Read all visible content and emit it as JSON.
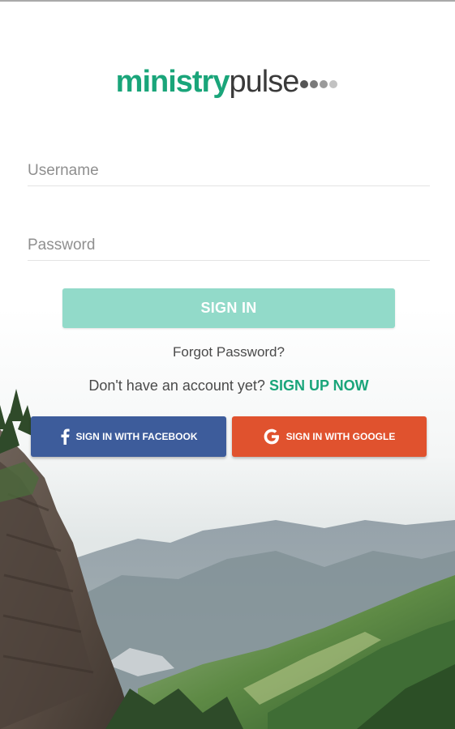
{
  "logo": {
    "bold_text": "ministry",
    "light_text": "pulse",
    "dot_colors": [
      "#555555",
      "#7a7a7a",
      "#9a9a9a",
      "#c2c2c2"
    ]
  },
  "form": {
    "username_placeholder": "Username",
    "password_placeholder": "Password",
    "signin_label": "SIGN IN"
  },
  "links": {
    "forgot_password": "Forgot Password?",
    "no_account_text": "Don't have an account yet?",
    "signup_label": "SIGN UP NOW"
  },
  "social": {
    "facebook_label": "SIGN IN WITH FACEBOOK",
    "google_label": "SIGN IN WITH GOOGLE",
    "facebook_icon": "facebook-icon",
    "google_icon": "google-icon"
  },
  "colors": {
    "brand_green": "#1aa57a",
    "signin_button": "#92dac9",
    "facebook_blue": "#3d5c9b",
    "google_red": "#e0522e"
  }
}
